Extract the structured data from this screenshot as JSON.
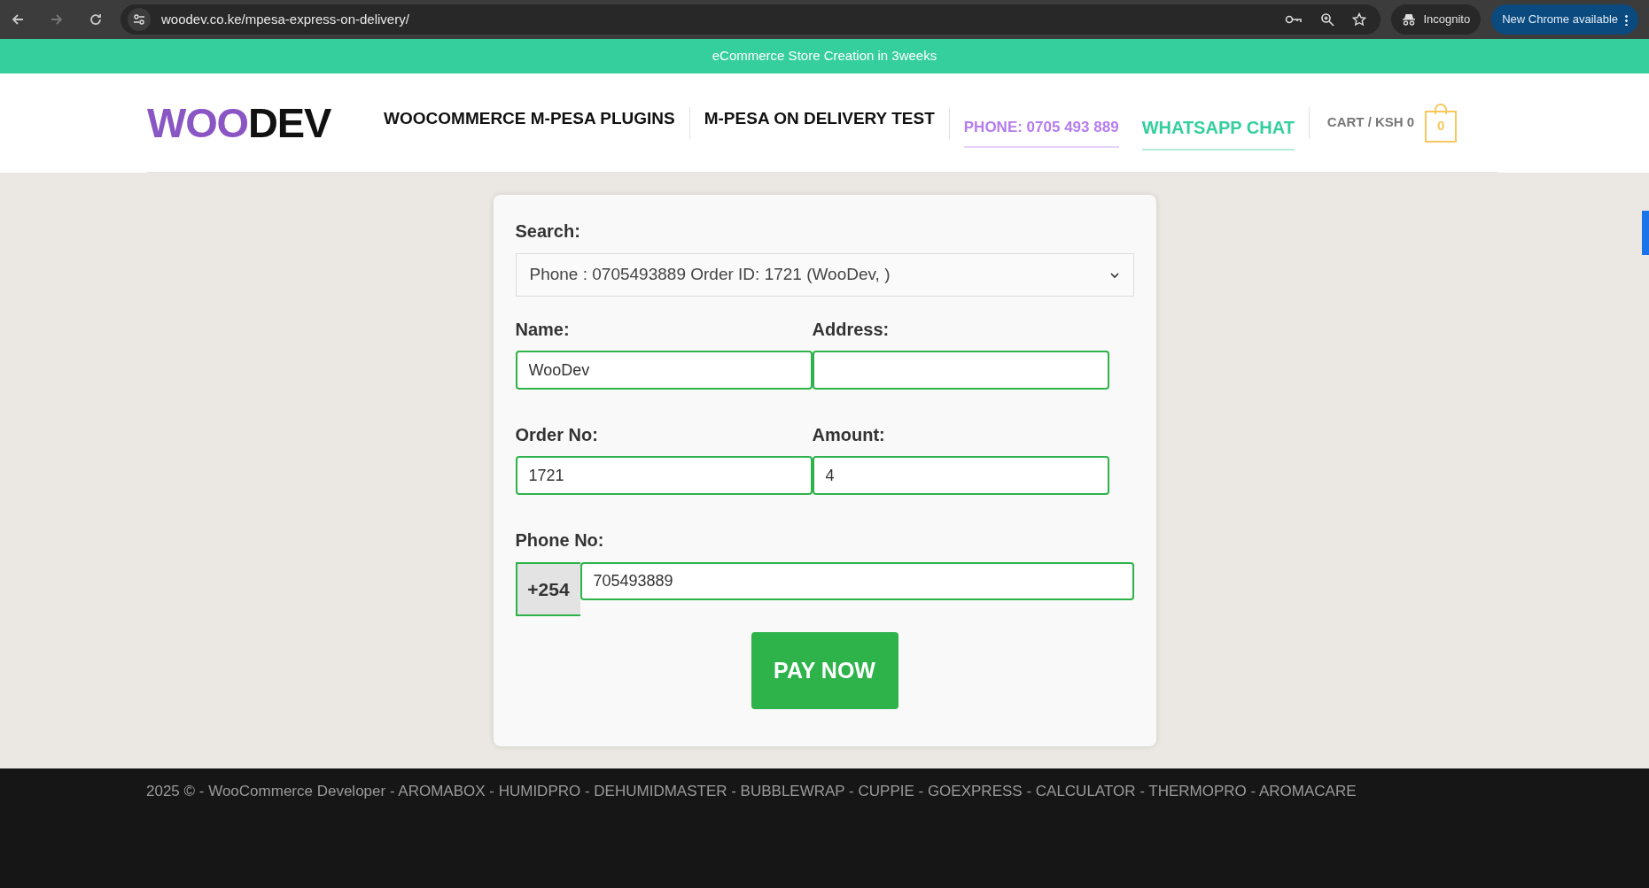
{
  "browser": {
    "url": "woodev.co.ke/mpesa-express-on-delivery/",
    "profile": "Incognito",
    "update_button": "New Chrome available"
  },
  "promo_bar": {
    "text": "eCommerce Store Creation in 3weeks"
  },
  "header": {
    "logo": {
      "part_1": "WOO",
      "part_2": "DEV"
    },
    "nav": [
      {
        "label": "WOOCOMMERCE M-PESA PLUGINS",
        "kind": "menu"
      },
      {
        "label": "M-PESA ON DELIVERY TEST",
        "kind": "menu"
      },
      {
        "label": "PHONE: 0705 493 889",
        "kind": "phone"
      },
      {
        "label": "WHATSAPP CHAT",
        "kind": "whatsapp"
      }
    ],
    "cart": {
      "label": "CART / KSH 0",
      "count": "0"
    }
  },
  "form": {
    "search": {
      "label": "Search:",
      "value": "Phone : 0705493889 Order ID: 1721 (WooDev, )"
    },
    "fields": [
      {
        "label": "Name:",
        "value": "WooDev"
      },
      {
        "label": "Address:"
      },
      {
        "label": "Order No:",
        "value": "1721"
      },
      {
        "label": "Amount:",
        "value": "4"
      }
    ],
    "phone": {
      "label": "Phone No:",
      "prefix": "+254",
      "value": "705493889"
    },
    "submit": "PAY NOW"
  },
  "footer": {
    "text": "2025 © - WooCommerce Developer - AROMABOX - HUMIDPRO - DEHUMIDMASTER - BUBBLEWRAP - CUPPIE - GOEXPRESS - CALCULATOR - THERMOPRO - AROMACARE"
  }
}
